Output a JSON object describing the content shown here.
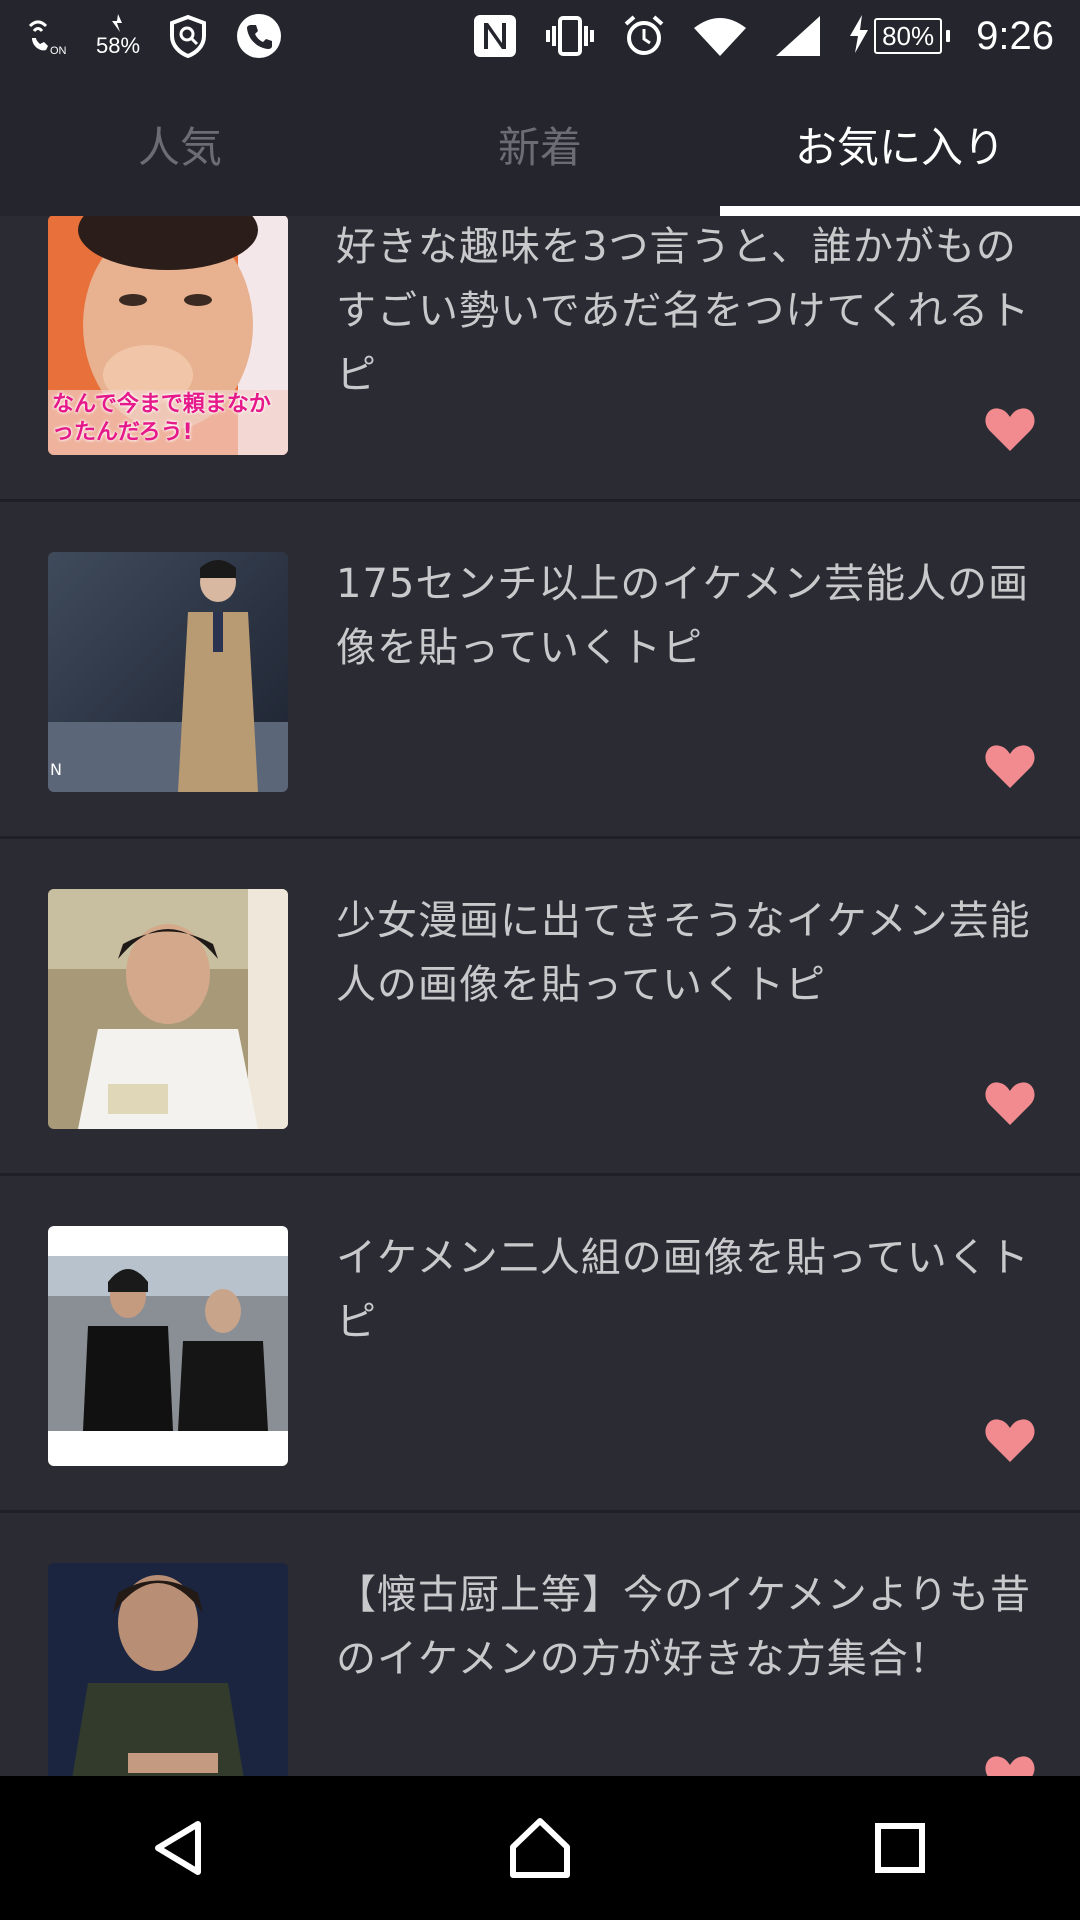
{
  "status_bar": {
    "left_icons": [
      "wifi-calling-on-icon",
      "data-saver-icon",
      "shield-icon",
      "phone-icon"
    ],
    "data_percent": "58%",
    "right_icons": [
      "nfc-icon",
      "vibrate-icon",
      "alarm-icon",
      "wifi-icon",
      "signal-icon",
      "charging-icon"
    ],
    "battery": "80%",
    "time": "9:26"
  },
  "tabs": [
    {
      "label": "人気",
      "active": false
    },
    {
      "label": "新着",
      "active": false
    },
    {
      "label": "お気に入り",
      "active": true
    }
  ],
  "items": [
    {
      "title": "好きな趣味を3つ言うと、誰かがものすごい勢いであだ名をつけてくれるトピ",
      "thumb_caption": "なんで今まで頼まなかったんだろう!",
      "favorited": true
    },
    {
      "title": "175センチ以上のイケメン芸能人の画像を貼っていくトピ",
      "thumb_caption": "N",
      "favorited": true
    },
    {
      "title": "少女漫画に出てきそうなイケメン芸能人の画像を貼っていくトピ",
      "favorited": true
    },
    {
      "title": "イケメン二人組の画像を貼っていくトピ",
      "favorited": true
    },
    {
      "title": "【懐古厨上等】今のイケメンよりも昔のイケメンの方が好きな方集合！",
      "favorited": true
    }
  ],
  "colors": {
    "background": "#2a2b33",
    "tab_active": "#ffffff",
    "tab_inactive": "#6c6d74",
    "heart": "#f28b8f"
  },
  "navbar": [
    "back-icon",
    "home-icon",
    "recents-icon"
  ]
}
